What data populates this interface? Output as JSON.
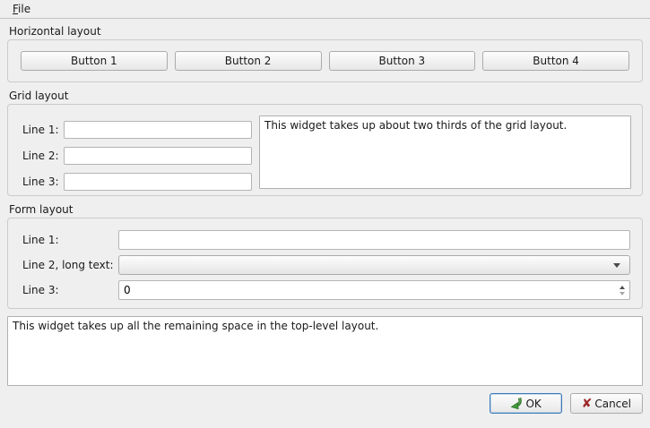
{
  "menubar": {
    "file": {
      "accel": "F",
      "rest": "ile",
      "label": "File"
    }
  },
  "groups": {
    "horizontal": {
      "title": "Horizontal layout",
      "buttons": [
        "Button 1",
        "Button 2",
        "Button 3",
        "Button 4"
      ]
    },
    "grid": {
      "title": "Grid layout",
      "rows": [
        {
          "label": "Line 1:",
          "value": ""
        },
        {
          "label": "Line 2:",
          "value": ""
        },
        {
          "label": "Line 3:",
          "value": ""
        }
      ],
      "textedit": "This widget takes up about two thirds of the grid layout."
    },
    "form": {
      "title": "Form layout",
      "rows": [
        {
          "label": "Line 1:",
          "type": "lineedit",
          "value": ""
        },
        {
          "label": "Line 2, long text:",
          "type": "combobox",
          "value": ""
        },
        {
          "label": "Line 3:",
          "type": "spinbox",
          "value": "0"
        }
      ]
    }
  },
  "bottom_textedit": "This widget takes up all the remaining space in the top-level layout.",
  "dialog_buttons": {
    "ok": "OK",
    "cancel": "Cancel"
  },
  "icons": {
    "ok_icon_name": "green-apply-arrow-icon",
    "cancel_glyph": "✘"
  },
  "colors": {
    "window_background": "#efefef",
    "focus_border_blue": "#3a7ab8",
    "ok_icon_green": "#3f9c35",
    "cancel_icon_red": "#9e2a2a"
  }
}
